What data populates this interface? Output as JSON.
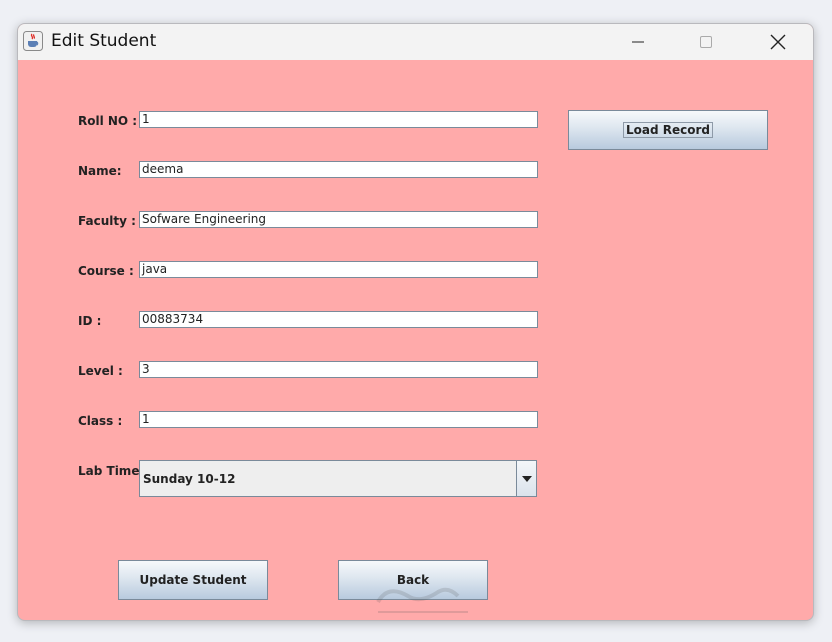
{
  "window": {
    "title": "Edit Student",
    "background": "#ffaaaa"
  },
  "form": {
    "fields": [
      {
        "label": "Roll NO :",
        "value": "1"
      },
      {
        "label": "Name:",
        "value": "deema"
      },
      {
        "label": "Faculty :",
        "value": "Sofware Engineering"
      },
      {
        "label": "Course :",
        "value": "java"
      },
      {
        "label": "ID :",
        "value": "00883734"
      },
      {
        "label": "Level :",
        "value": "3"
      },
      {
        "label": "Class :",
        "value": "1"
      }
    ],
    "lab_time": {
      "label": "Lab Time:",
      "selected": "Sunday 10-12"
    }
  },
  "buttons": {
    "load_record": "Load Record",
    "update_student": "Update Student",
    "back": "Back"
  },
  "icons": {
    "app": "java-coffee-icon",
    "minimize": "minimize-icon",
    "maximize": "maximize-icon",
    "close": "close-icon",
    "dropdown": "chevron-down-icon"
  }
}
